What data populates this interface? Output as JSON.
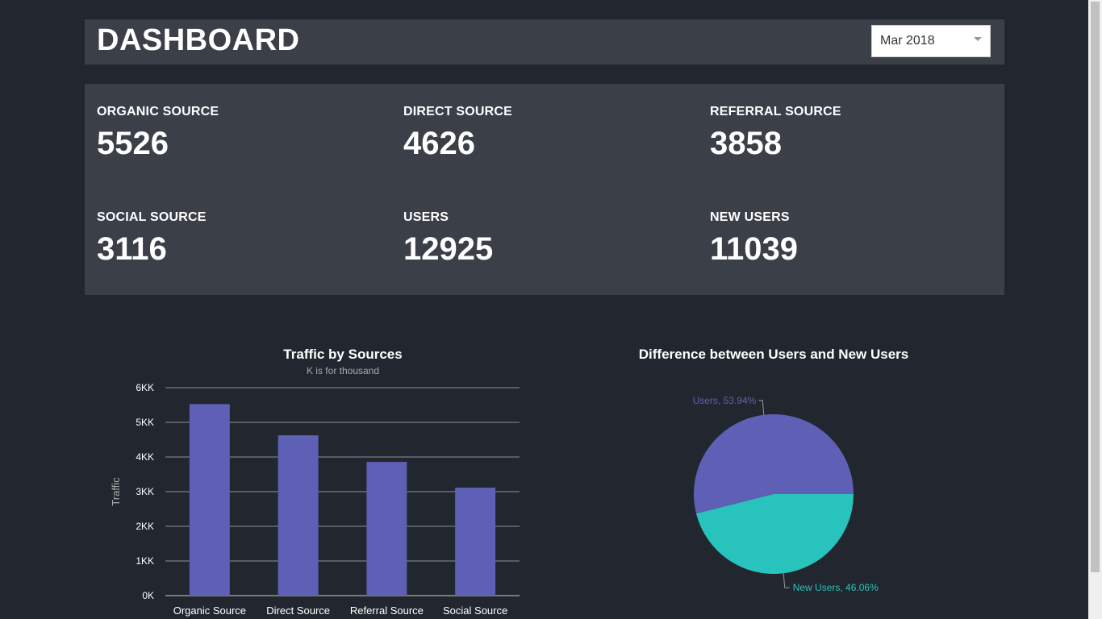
{
  "header": {
    "title": "DASHBOARD",
    "month_selected": "Mar 2018"
  },
  "stats": [
    {
      "label": "ORGANIC SOURCE",
      "value": "5526"
    },
    {
      "label": "DIRECT SOURCE",
      "value": "4626"
    },
    {
      "label": "REFERRAL SOURCE",
      "value": "3858"
    },
    {
      "label": "SOCIAL SOURCE",
      "value": "3116"
    },
    {
      "label": "USERS",
      "value": "12925"
    },
    {
      "label": "NEW USERS",
      "value": "11039"
    }
  ],
  "colors": {
    "background": "#22272f",
    "panel": "#3a3f48",
    "bar": "#5e60b5",
    "users": "#5e60b5",
    "new_users": "#29c3be"
  },
  "chart_data": [
    {
      "type": "bar",
      "title": "Traffic by Sources",
      "subtitle": "K is for thousand",
      "xlabel": "",
      "ylabel": "Traffic",
      "categories": [
        "Organic Source",
        "Direct Source",
        "Referral Source",
        "Social Source"
      ],
      "values": [
        5526,
        4626,
        3858,
        3116
      ],
      "ylim": [
        0,
        6000
      ],
      "yticks": [
        0,
        1000,
        2000,
        3000,
        4000,
        5000,
        6000
      ],
      "ytick_labels": [
        "0K",
        "1KK",
        "2KK",
        "3KK",
        "4KK",
        "5KK",
        "6KK"
      ],
      "grid": true
    },
    {
      "type": "pie",
      "title": "Difference between Users and New Users",
      "slices": [
        {
          "label": "Users",
          "value": 53.94,
          "display": "Users, 53.94%"
        },
        {
          "label": "New Users",
          "value": 46.06,
          "display": "New Users, 46.06%"
        }
      ]
    }
  ]
}
